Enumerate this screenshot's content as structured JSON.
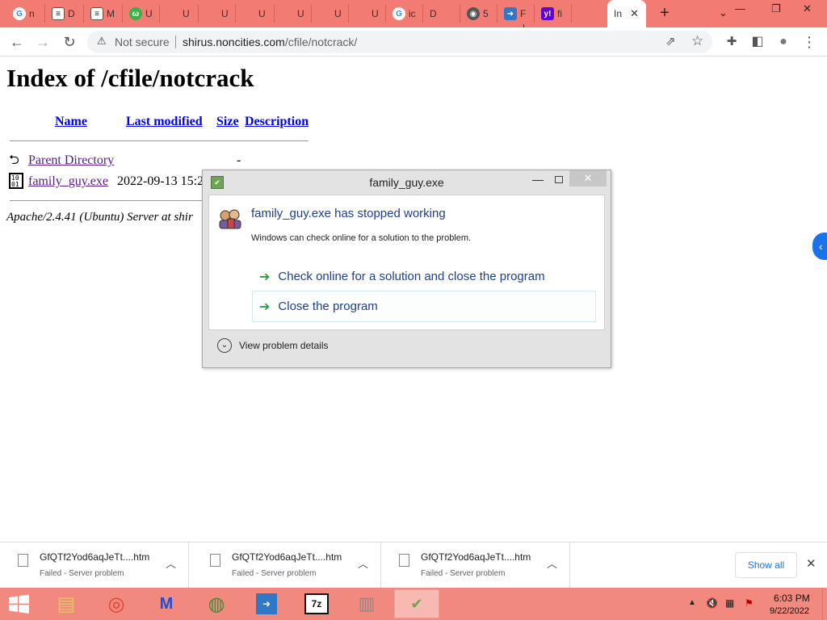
{
  "browser": {
    "tabs": [
      {
        "icon": "google-icon",
        "glyph": "G",
        "label": "n"
      },
      {
        "icon": "stack-icon",
        "glyph": "≡",
        "label": "D"
      },
      {
        "icon": "stack-icon",
        "glyph": "≡",
        "label": "M"
      },
      {
        "icon": "leaf-icon",
        "glyph": "ω",
        "label": "U"
      },
      {
        "icon": "blank-icon",
        "glyph": "",
        "label": "U"
      },
      {
        "icon": "blank-icon",
        "glyph": "",
        "label": "U"
      },
      {
        "icon": "blank-icon",
        "glyph": "",
        "label": "U"
      },
      {
        "icon": "blank-icon",
        "glyph": "",
        "label": "U"
      },
      {
        "icon": "blank-icon",
        "glyph": "",
        "label": "U"
      },
      {
        "icon": "blank-icon",
        "glyph": "",
        "label": "U"
      },
      {
        "icon": "google-icon",
        "glyph": "G",
        "label": "ic"
      },
      {
        "icon": "download-icon",
        "glyph": "⤓",
        "label": "D"
      },
      {
        "icon": "globe-icon",
        "glyph": "◉",
        "label": "5"
      },
      {
        "icon": "arrow-app-icon",
        "glyph": "➜",
        "label": "F"
      },
      {
        "icon": "yahoo-icon",
        "glyph": "y!",
        "label": "fi"
      }
    ],
    "active_tab": {
      "label": "In",
      "close": "✕"
    },
    "new_tab": "+",
    "tab_search": "⌄",
    "window_controls": {
      "minimize": "—",
      "restore": "❐",
      "close": "✕"
    },
    "toolbar": {
      "back": "←",
      "forward": "→",
      "reload": "↻",
      "security_icon": "⚠",
      "security_label": "Not secure",
      "url_host": "shirus.noncities.com",
      "url_path": "/cfile/notcrack/",
      "share": "⇗",
      "bookmark": "☆",
      "extensions": "✚",
      "sidepanel": "◧",
      "profile": "●",
      "menu": "⋮"
    }
  },
  "listing": {
    "title": "Index of /cfile/notcrack",
    "columns": {
      "name": "Name",
      "last_modified": "Last modified",
      "size": "Size",
      "description": "Description"
    },
    "parent": {
      "icon": "back-arrow-icon",
      "label": "Parent Directory",
      "size": "-"
    },
    "files": [
      {
        "icon": "binary-file-icon",
        "name": "family_guy.exe",
        "last_modified": "2022-09-13 15:2"
      }
    ],
    "footer": "Apache/2.4.41 (Ubuntu) Server at shir"
  },
  "side_button": "‹",
  "dialog": {
    "title": "family_guy.exe",
    "heading": "family_guy.exe has stopped working",
    "message": "Windows can check online for a solution to the problem.",
    "options": [
      "Check online for a solution and close the program",
      "Close the program"
    ],
    "details_label": "View problem details"
  },
  "downloads": {
    "items": [
      {
        "name": "GfQTf2Yod6aqJeTt....htm",
        "status": "Failed - Server problem"
      },
      {
        "name": "GfQTf2Yod6aqJeTt....htm",
        "status": "Failed - Server problem"
      },
      {
        "name": "GfQTf2Yod6aqJeTt....htm",
        "status": "Failed - Server problem"
      }
    ],
    "show_all": "Show all",
    "close": "✕"
  },
  "taskbar": {
    "apps": [
      {
        "name": "file-explorer-icon",
        "glyph": "▤",
        "color": "#e6c36a"
      },
      {
        "name": "chrome-icon",
        "glyph": "◎",
        "color": "#db4437"
      },
      {
        "name": "malwarebytes-icon",
        "glyph": "M",
        "color": "#1d4fd8"
      },
      {
        "name": "internet-download-manager-icon",
        "glyph": "◍",
        "color": "#3b8d3b"
      },
      {
        "name": "arrow-app-icon",
        "glyph": "➜",
        "color": "#2e78c6"
      },
      {
        "name": "7zip-icon",
        "glyph": "7z",
        "color": "#111111"
      },
      {
        "name": "archive-icon",
        "glyph": "▥",
        "color": "#8a8a8a"
      },
      {
        "name": "problem-reporting-icon",
        "glyph": "✔",
        "color": "#6aa84f"
      }
    ],
    "tray_up": "▲",
    "time": "6:03 PM",
    "date": "9/22/2022"
  },
  "colors": {
    "tab_strip": "#f27b74",
    "taskbar": "#f2897f",
    "link": "#0000ee",
    "visited_link": "#551a8b",
    "dialog_heading": "#1e3f8a",
    "option_arrow": "#2ea044"
  }
}
